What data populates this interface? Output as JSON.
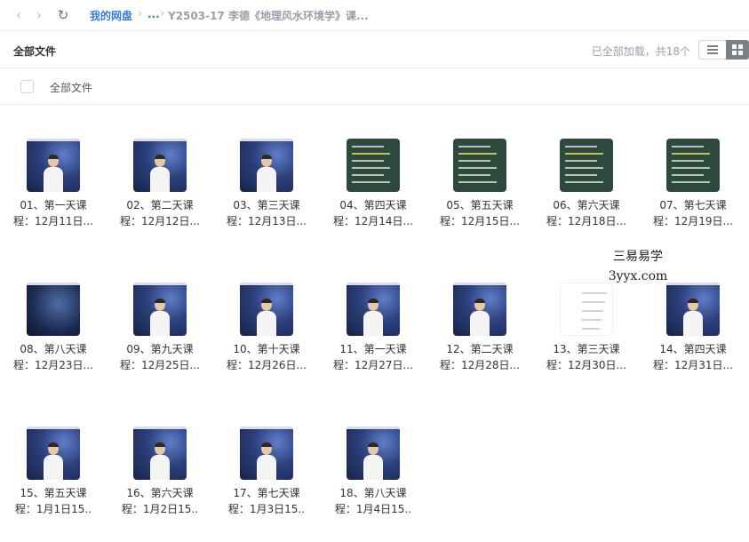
{
  "nav": {
    "back": "‹",
    "forward": "›",
    "refresh": "↻"
  },
  "breadcrumb": {
    "root": "我的网盘",
    "sep": "›",
    "ellipsis": "...",
    "current": "Y2503-17 李德《地理风水环境学》课..."
  },
  "header": {
    "title": "全部文件",
    "summary": "已全部加载，共18个"
  },
  "select_all": {
    "label": "全部文件"
  },
  "watermark": {
    "line1": "三易易学",
    "line2": "3yyx.com"
  },
  "files": [
    {
      "l1": "01、第一天课",
      "l2": "程：12月11日...",
      "kind": "video"
    },
    {
      "l1": "02、第二天课",
      "l2": "程：12月12日...",
      "kind": "video"
    },
    {
      "l1": "03、第三天课",
      "l2": "程：12月13日...",
      "kind": "video"
    },
    {
      "l1": "04、第四天课",
      "l2": "程：12月14日...",
      "kind": "board"
    },
    {
      "l1": "05、第五天课",
      "l2": "程：12月15日...",
      "kind": "board"
    },
    {
      "l1": "06、第六天课",
      "l2": "程：12月18日...",
      "kind": "board"
    },
    {
      "l1": "07、第七天课",
      "l2": "程：12月19日...",
      "kind": "board"
    },
    {
      "l1": "08、第八天课",
      "l2": "程：12月23日...",
      "kind": "space"
    },
    {
      "l1": "09、第九天课",
      "l2": "程：12月25日...",
      "kind": "video"
    },
    {
      "l1": "10、第十天课",
      "l2": "程：12月26日...",
      "kind": "video"
    },
    {
      "l1": "11、第一天课",
      "l2": "程：12月27日...",
      "kind": "video"
    },
    {
      "l1": "12、第二天课",
      "l2": "程：12月28日...",
      "kind": "video"
    },
    {
      "l1": "13、第三天课",
      "l2": "程：12月30日...",
      "kind": "doc"
    },
    {
      "l1": "14、第四天课",
      "l2": "程：12月31日...",
      "kind": "video"
    },
    {
      "l1": "15、第五天课",
      "l2": "程：1月1日15..",
      "kind": "video"
    },
    {
      "l1": "16、第六天课",
      "l2": "程：1月2日15..",
      "kind": "video"
    },
    {
      "l1": "17、第七天课",
      "l2": "程：1月3日15..",
      "kind": "video"
    },
    {
      "l1": "18、第八天课",
      "l2": "程：1月4日15..",
      "kind": "video"
    }
  ]
}
